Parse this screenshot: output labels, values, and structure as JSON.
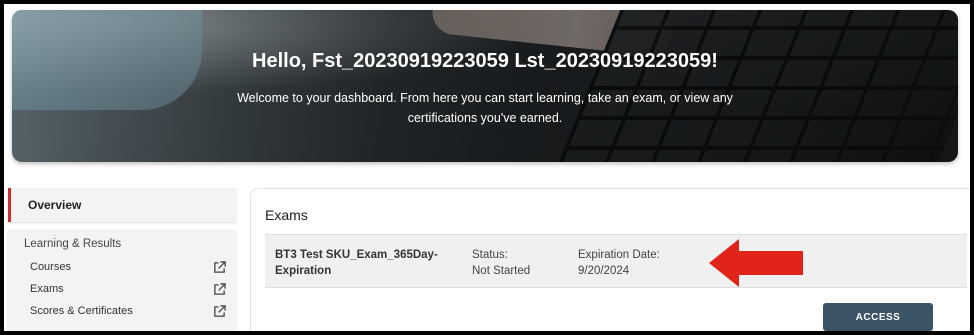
{
  "hero": {
    "greeting": "Hello, Fst_20230919223059 Lst_20230919223059!",
    "subtitle": "Welcome to your dashboard. From here you can start learning, take an exam, or view any certifications you've earned."
  },
  "sidebar": {
    "overview_label": "Overview",
    "group_title": "Learning & Results",
    "items": [
      {
        "label": "Courses",
        "icon": "external-link-icon"
      },
      {
        "label": "Exams",
        "icon": "external-link-icon"
      },
      {
        "label": "Scores & Certificates",
        "icon": "external-link-icon"
      }
    ]
  },
  "main": {
    "section_title": "Exams",
    "exam": {
      "name": "BT3 Test SKU_Exam_365Day-Expiration",
      "status_label": "Status:",
      "status_value": "Not Started",
      "expiration_label": "Expiration Date:",
      "expiration_value": "9/20/2024"
    },
    "access_label": "ACCESS"
  },
  "colors": {
    "accent_red": "#c9302c",
    "arrow_red": "#e02419",
    "button_bg": "#3d5466"
  }
}
